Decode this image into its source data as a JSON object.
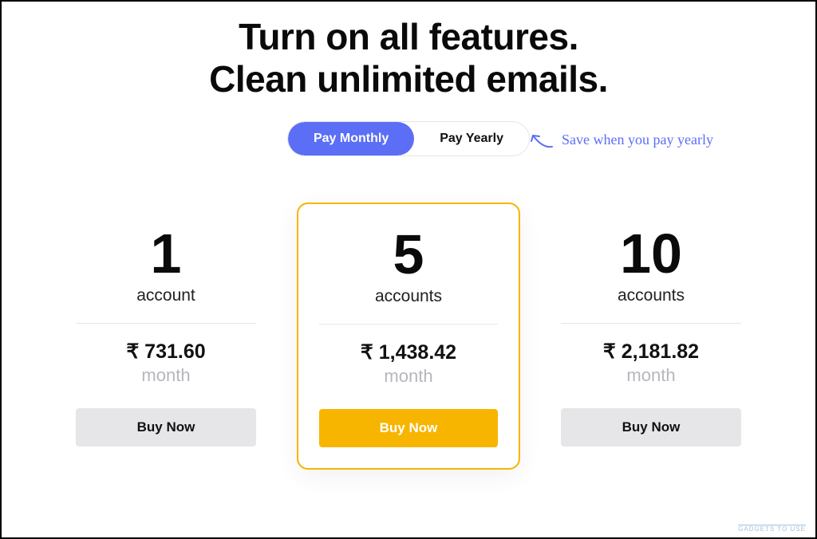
{
  "headline": {
    "line1": "Turn on all features.",
    "line2": "Clean unlimited emails."
  },
  "toggle": {
    "monthly": "Pay Monthly",
    "yearly": "Pay Yearly",
    "active": "monthly"
  },
  "annotation": "Save when you pay yearly",
  "plans": [
    {
      "qty": "1",
      "unit": "account",
      "price": "₹ 731.60",
      "period": "month",
      "cta": "Buy Now",
      "highlight": false
    },
    {
      "qty": "5",
      "unit": "accounts",
      "price": "₹ 1,438.42",
      "period": "month",
      "cta": "Buy Now",
      "highlight": true
    },
    {
      "qty": "10",
      "unit": "accounts",
      "price": "₹ 2,181.82",
      "period": "month",
      "cta": "Buy Now",
      "highlight": false
    }
  ],
  "watermark": "GADGETS TO USE",
  "colors": {
    "accent_blue": "#5b6ef5",
    "accent_gold": "#f7b500",
    "button_gray": "#e6e6e9",
    "muted_text": "#b6b6bd"
  }
}
